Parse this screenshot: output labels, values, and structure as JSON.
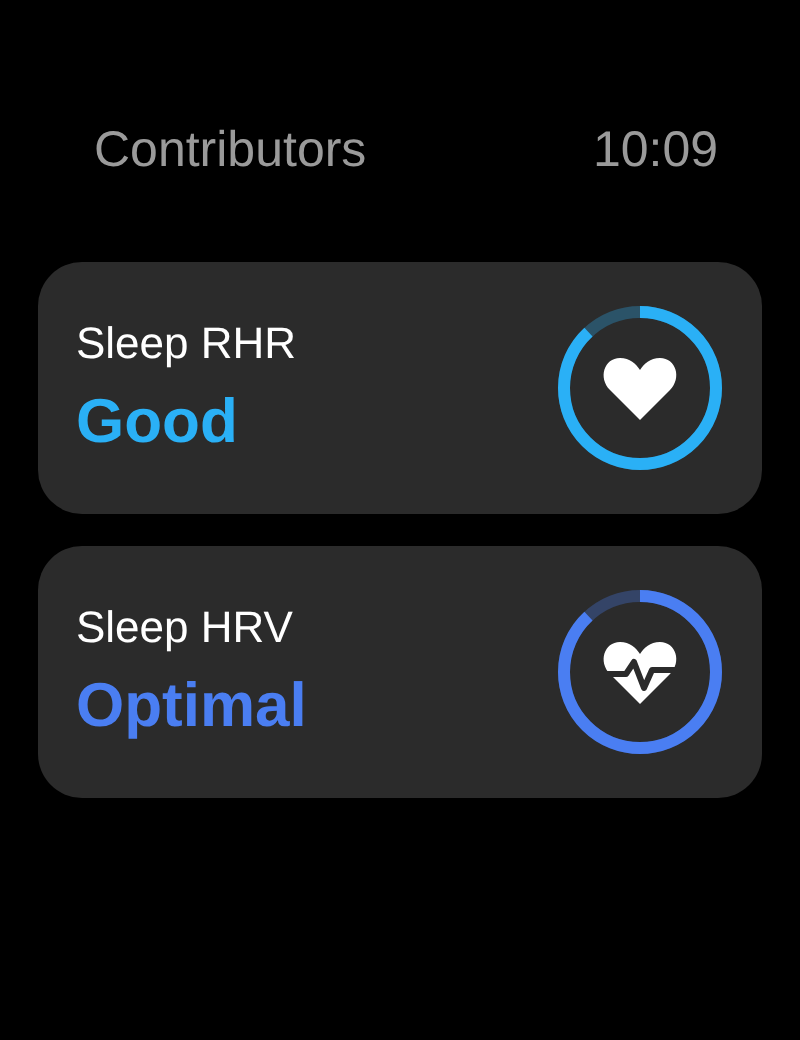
{
  "header": {
    "title": "Contributors",
    "time": "10:09"
  },
  "cards": [
    {
      "label": "Sleep RHR",
      "rating": "Good",
      "kind": "heart",
      "color": "#2ab0f6"
    },
    {
      "label": "Sleep HRV",
      "rating": "Optimal",
      "kind": "pulse",
      "color": "#4a7ef2"
    }
  ]
}
